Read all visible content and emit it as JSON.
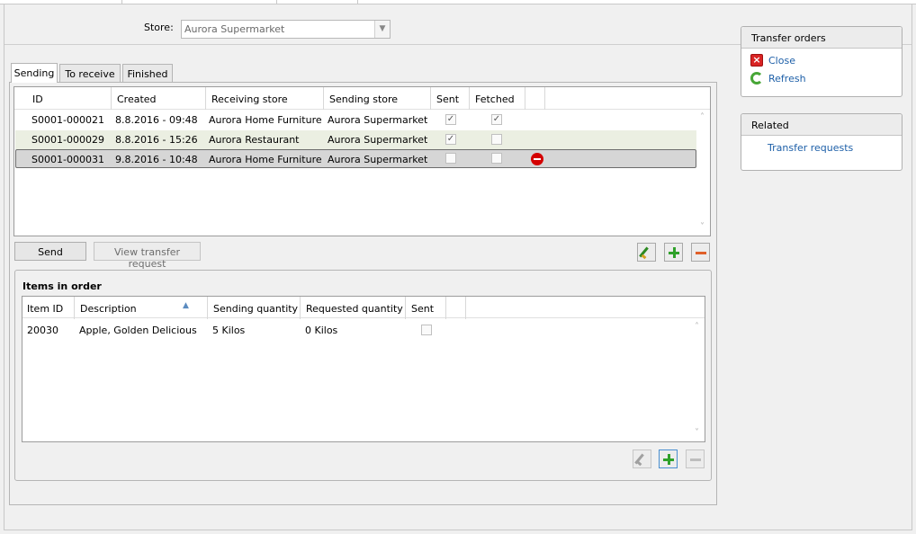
{
  "store": {
    "label": "Store:",
    "value": "Aurora Supermarket"
  },
  "tabs": [
    {
      "label": "Sending",
      "active": true
    },
    {
      "label": "To receive",
      "active": false
    },
    {
      "label": "Finished",
      "active": false
    }
  ],
  "orders": {
    "columns": [
      "ID",
      "Created",
      "Receiving store",
      "Sending store",
      "Sent",
      "Fetched"
    ],
    "rows": [
      {
        "id": "S0001-000021",
        "created": "8.8.2016 - 09:48",
        "receiving": "Aurora Home Furniture",
        "sending": "Aurora Supermarket",
        "sent": true,
        "fetched": true,
        "removable": false
      },
      {
        "id": "S0001-000029",
        "created": "8.8.2016 - 15:26",
        "receiving": "Aurora Restaurant",
        "sending": "Aurora Supermarket",
        "sent": true,
        "fetched": false,
        "removable": false
      },
      {
        "id": "S0001-000031",
        "created": "9.8.2016 - 10:48",
        "receiving": "Aurora Home Furniture",
        "sending": "Aurora Supermarket",
        "sent": false,
        "fetched": false,
        "removable": true
      }
    ]
  },
  "actions": {
    "send": "Send",
    "view_request": "View transfer request"
  },
  "items": {
    "title": "Items in order",
    "columns": [
      "Item ID",
      "Description",
      "Sending quantity",
      "Requested quantity",
      "Sent"
    ],
    "rows": [
      {
        "item_id": "20030",
        "description": "Apple, Golden Delicious",
        "sending_qty": "5 Kilos",
        "requested_qty": "0 Kilos",
        "sent": false
      }
    ]
  },
  "transfer_orders_panel": {
    "title": "Transfer orders",
    "close": "Close",
    "refresh": "Refresh"
  },
  "related_panel": {
    "title": "Related",
    "transfer_requests": "Transfer requests"
  },
  "colors": {
    "selected_row": "#d6d6d6",
    "alt_row": "#ebefe2",
    "link": "#1d5fa8",
    "remove": "#d40000",
    "add": "#2fa12a"
  },
  "icons": [
    "pencil-icon",
    "plus-icon",
    "minus-icon",
    "remove-icon",
    "close-icon",
    "refresh-icon",
    "sort-ascending-icon"
  ]
}
